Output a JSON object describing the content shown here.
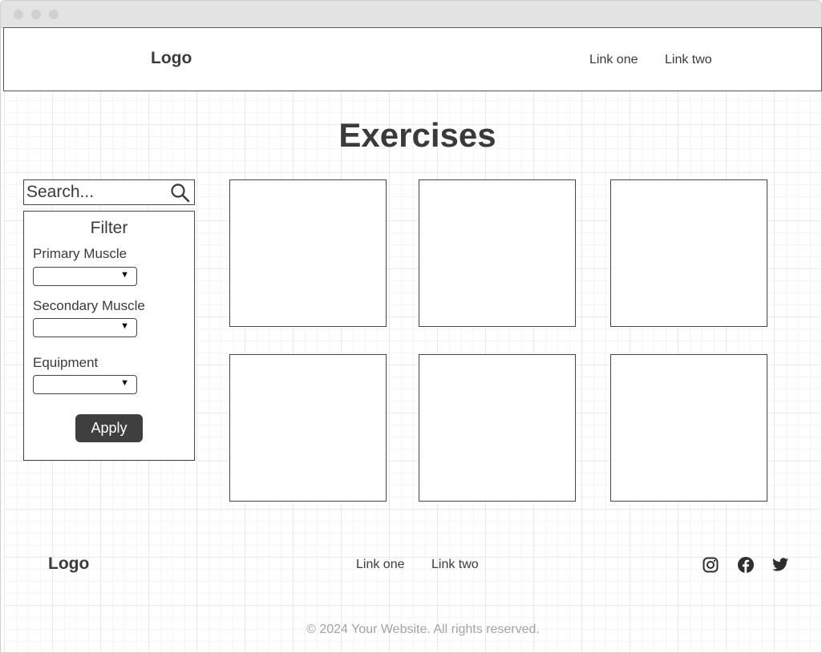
{
  "header": {
    "logo": "Logo",
    "links": [
      "Link one",
      "Link two"
    ]
  },
  "main": {
    "title": "Exercises",
    "search": {
      "placeholder": "Search...",
      "icon": "search-icon"
    },
    "filter": {
      "title": "Filter",
      "fields": [
        {
          "label": "Primary Muscle",
          "value": ""
        },
        {
          "label": "Secondary Muscle",
          "value": ""
        },
        {
          "label": "Equipment",
          "value": ""
        }
      ],
      "apply_label": "Apply"
    },
    "card_count": 6
  },
  "footer": {
    "logo": "Logo",
    "links": [
      "Link one",
      "Link two"
    ],
    "social_icons": [
      "instagram-icon",
      "facebook-icon",
      "twitter-icon"
    ],
    "copyright": "© 2024 Your Website. All rights reserved."
  },
  "colors": {
    "button_bg": "#3f3f3f",
    "text": "#3a3a3a",
    "muted_text": "#a3a3a3"
  }
}
